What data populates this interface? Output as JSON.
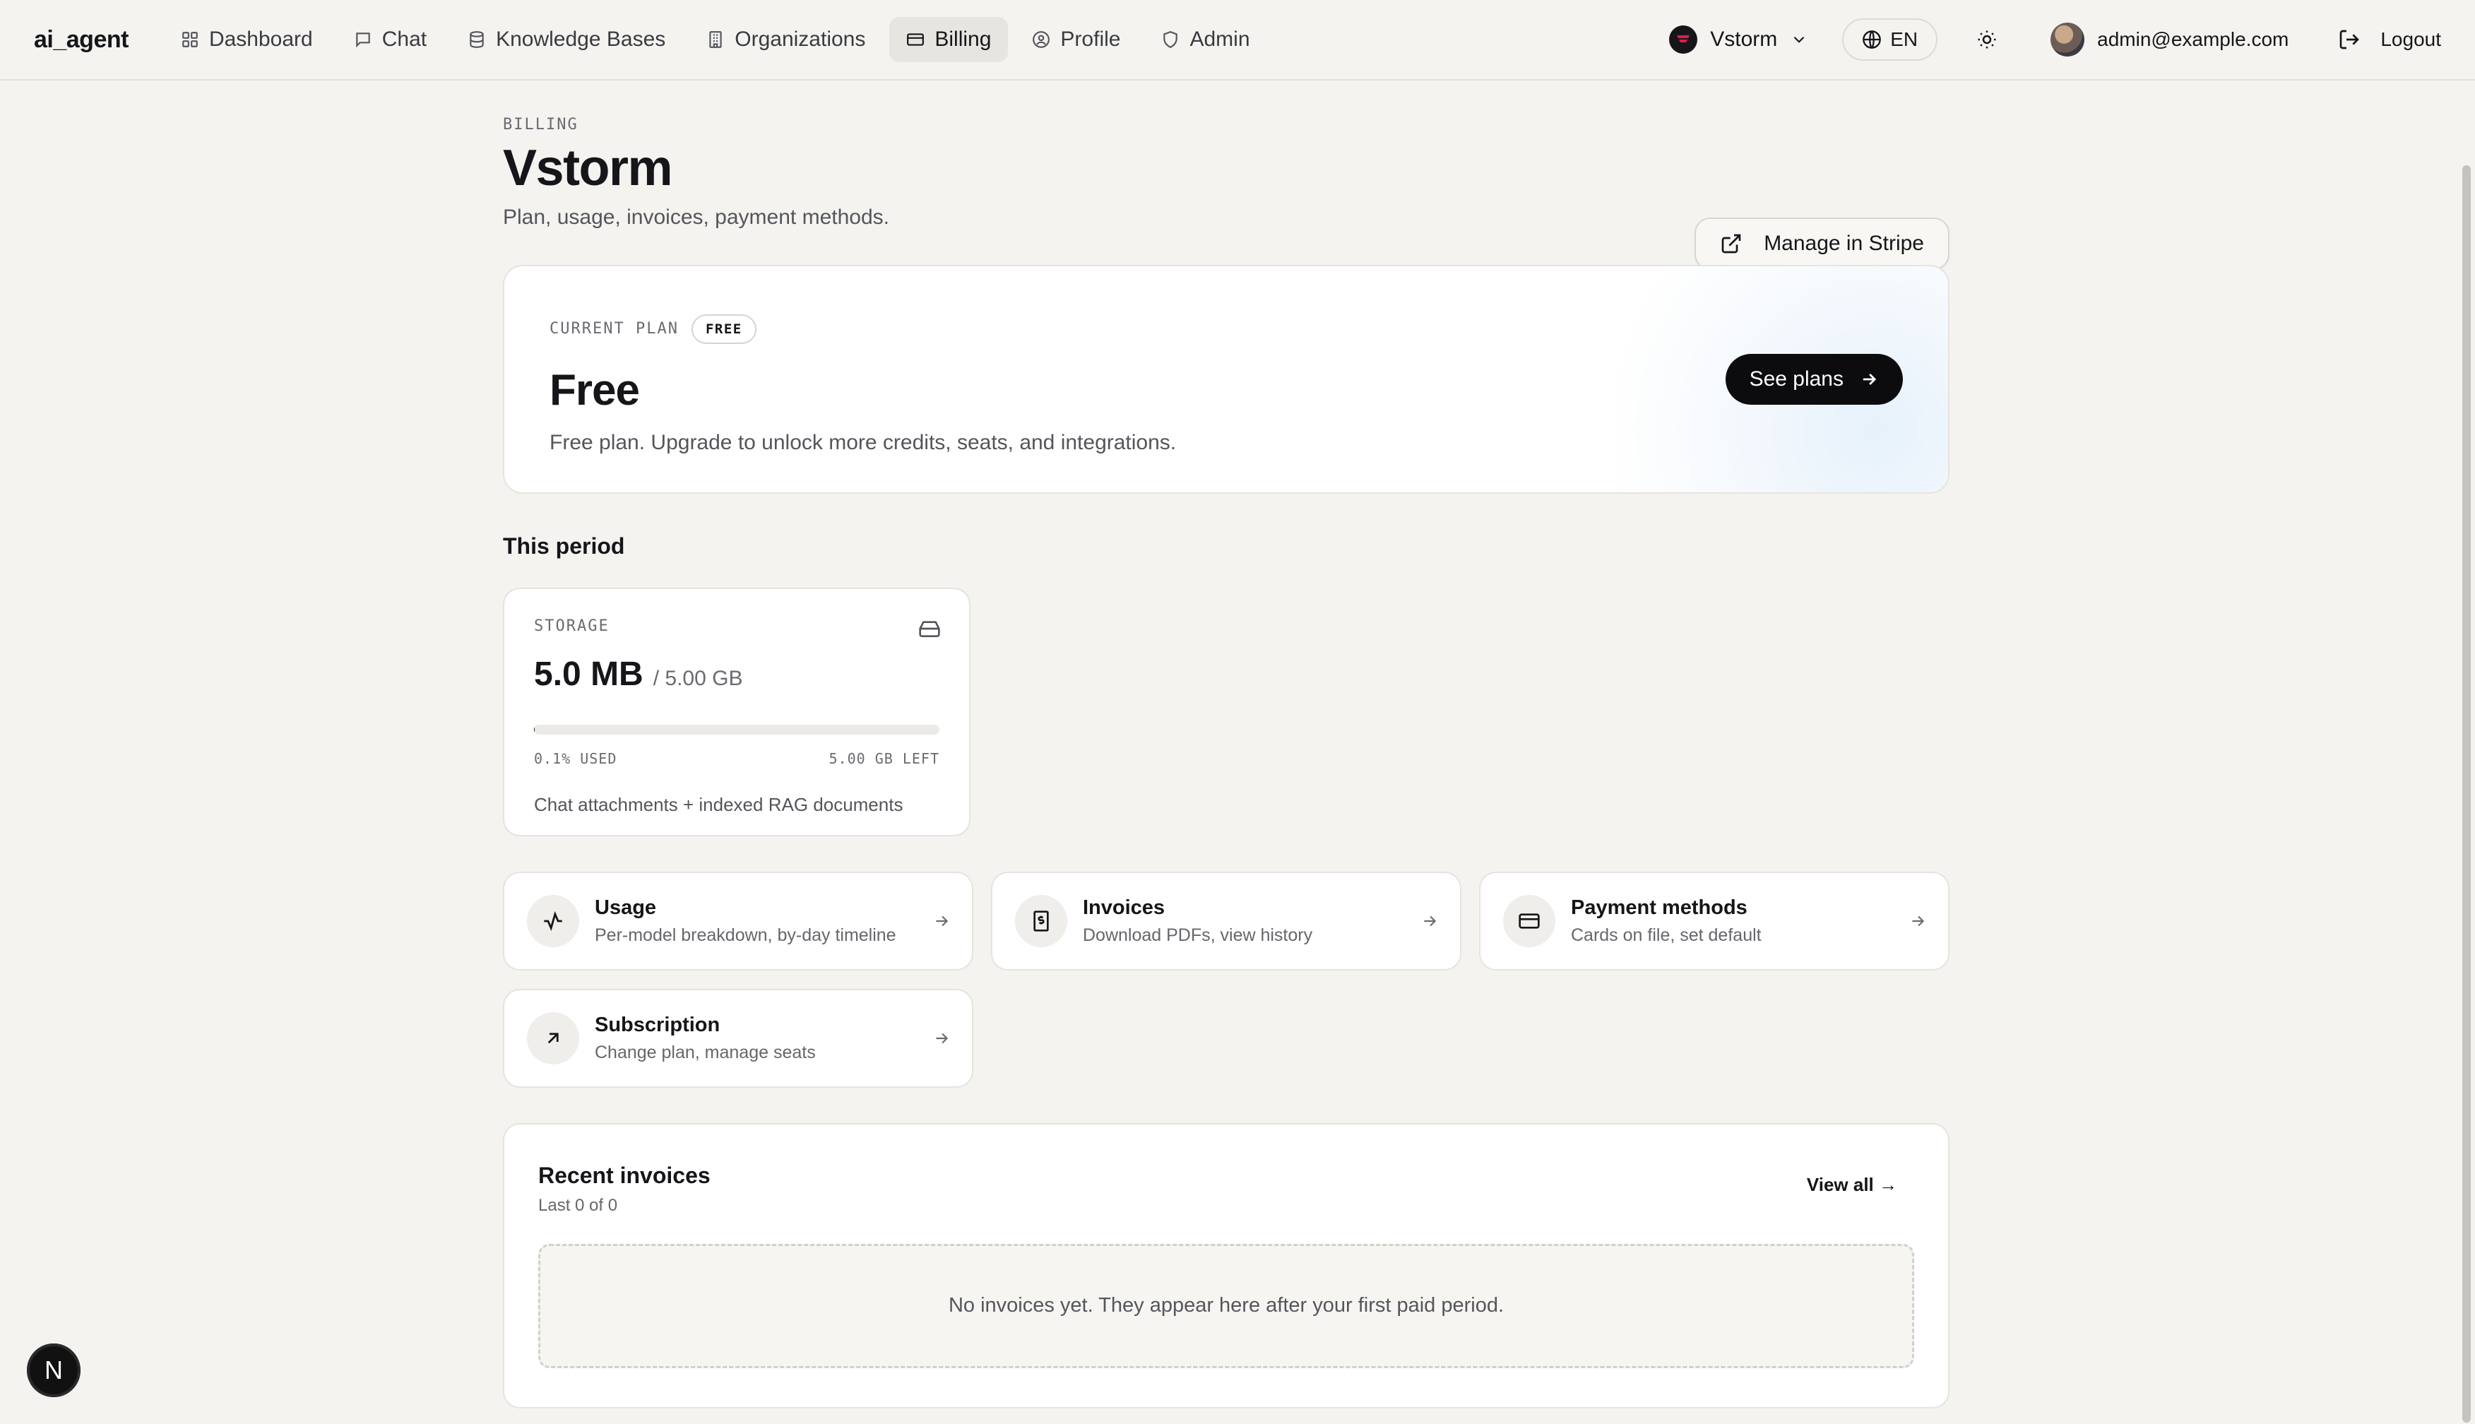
{
  "nav": {
    "brand": "ai_agent",
    "links": [
      {
        "label": "Dashboard",
        "icon": "grid-icon",
        "active": false
      },
      {
        "label": "Chat",
        "icon": "message-icon",
        "active": false
      },
      {
        "label": "Knowledge Bases",
        "icon": "database-icon",
        "active": false
      },
      {
        "label": "Organizations",
        "icon": "building-icon",
        "active": false
      },
      {
        "label": "Billing",
        "icon": "credit-card-icon",
        "active": true
      },
      {
        "label": "Profile",
        "icon": "user-circle-icon",
        "active": false
      },
      {
        "label": "Admin",
        "icon": "shield-icon",
        "active": false
      }
    ],
    "org": "Vstorm",
    "lang": "EN",
    "user_email": "admin@example.com",
    "logout": "Logout"
  },
  "header": {
    "eyebrow": "BILLING",
    "title": "Vstorm",
    "subtitle": "Plan, usage, invoices, payment methods.",
    "stripe_button": "Manage in Stripe"
  },
  "plan": {
    "eyebrow": "CURRENT PLAN",
    "badge": "FREE",
    "name": "Free",
    "description": "Free plan. Upgrade to unlock more credits, seats, and integrations.",
    "cta": "See plans"
  },
  "period": {
    "heading": "This period",
    "storage": {
      "label": "STORAGE",
      "used": "5.0 MB",
      "capacity": "/ 5.00 GB",
      "used_fraction": 0.001,
      "used_label": "0.1% USED",
      "left_label": "5.00 GB LEFT",
      "note": "Chat attachments + indexed RAG documents"
    }
  },
  "cards": [
    {
      "title": "Usage",
      "subtitle": "Per-model breakdown, by-day timeline",
      "icon": "activity-icon"
    },
    {
      "title": "Invoices",
      "subtitle": "Download PDFs, view history",
      "icon": "receipt-icon"
    },
    {
      "title": "Payment methods",
      "subtitle": "Cards on file, set default",
      "icon": "credit-card-icon"
    },
    {
      "title": "Subscription",
      "subtitle": "Change plan, manage seats",
      "icon": "arrow-up-right-icon"
    }
  ],
  "invoices": {
    "title": "Recent invoices",
    "subtitle": "Last 0 of 0",
    "view_all": "View all →",
    "empty": "No invoices yet. They appear here after your first paid period."
  },
  "next_badge": "N",
  "colors": {
    "accent": "#0c0c0f",
    "background": "#f4f3f0",
    "org_logo": "#e11d48"
  }
}
